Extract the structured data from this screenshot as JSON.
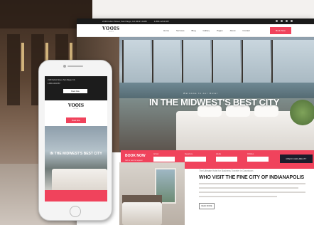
{
  "browser": {
    "topbar": {
      "address": "2130 Fulton Street, San Diego, CA 94117-1080",
      "phone": "1-800-1234-567"
    },
    "nav": {
      "logo": "VOOIS",
      "logo_sub": "HOTEL",
      "menu": [
        "Home",
        "Services",
        "Blog",
        "Gallery",
        "Pages",
        "About",
        "Contact"
      ],
      "cta": "Book Now"
    },
    "hero": {
      "kicker": "Welcome to our Hotel",
      "headline": "IN THE MIDWEST'S BEST CITY"
    },
    "booking": {
      "title": "BOOK NOW",
      "subtitle": "Call or send a request",
      "fields": [
        "Arrival",
        "Departure",
        "Adults",
        "Children"
      ],
      "button": "CHECK AVAILABILITY"
    },
    "about": {
      "pre": "The Ultimate Hotel for Business Traveler in Downtown",
      "title": "WHO VISIT THE FINE CITY OF INDIANAPOLIS",
      "more": "READ MORE"
    }
  },
  "phone": {
    "topline1": "2130 Fulton Street, San Diego, CA",
    "topline2": "1-800-1234-567",
    "topbtn": "Book Now",
    "logo": "VOOIS",
    "logo_sub": "HOTEL",
    "btn": "Book Now",
    "headline": "IN THE MIDWEST'S BEST CITY"
  },
  "colors": {
    "accent": "#f0435c",
    "dark": "#1c1c1c"
  }
}
